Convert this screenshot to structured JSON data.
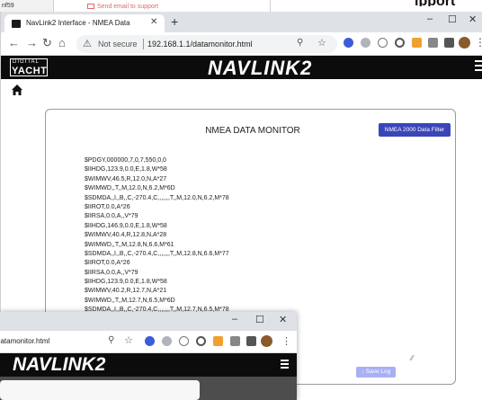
{
  "background_window": {
    "left_fragment": "nf59",
    "mail_link": "Send email to support",
    "right_fragment": "ipport"
  },
  "browser": {
    "tab_title": "NavLink2 Interface - NMEA Data",
    "address": {
      "security": "Not secure",
      "url": "192.168.1.1/datamonitor.html"
    },
    "window_controls": {
      "minimize": "–",
      "maximize": "☐",
      "close": "✕"
    }
  },
  "site": {
    "logo_line1": "DIGITAL",
    "logo_line2": "YACHT",
    "brand": "NAVLINK2"
  },
  "monitor": {
    "title": "NMEA DATA MONITOR",
    "filter_button": "NMEA 2000 Data Filter",
    "save_button": "↓ Save Log",
    "lines": [
      "$PDGY,000000,7,0,7,550,0,0",
      "$IIHDG,123.9,0.0,E,1.8,W*58",
      "$WIMWV,46.5,R,12.0,N,A*27",
      "$WIMWD,,T,,M,12.0,N,6.2,M*6D",
      "$SDMDA,,I,,B,,C,-270.4,C,,,,,,,T,,M,12.0,N,6.2,M*78",
      "$IIROT,0.0,A*26",
      "$IIRSA,0.0,A,,V*79",
      "$IIHDG,146.9,0.0,E,1.8,W*58",
      "$WIMWV,40.4,R,12.8,N,A*28",
      "$WIMWD,,T,,M,12.8,N,6.6,M*61",
      "$SDMDA,,I,,B,,C,-270.4,C,,,,,,,T,,M,12.8,N,6.6,M*77",
      "$IIROT,0.0,A*26",
      "$IIRSA,0.0,A,,V*79",
      "$IIHDG,123.9,0.0,E,1.8,W*58",
      "$WIMWV,40.2,R,12.7,N,A*21",
      "$WIMWD,,T,,M,12.7,N,6.5,M*6D",
      "$SDMDA,,I,,B,,C,-270.4,C,,,,,,,T,,M,12.7,N,6.5,M*78"
    ]
  },
  "second_window": {
    "url_fragment": "datamonitor.html",
    "brand": "NAVLINK2",
    "window_controls": {
      "minimize": "–",
      "maximize": "☐",
      "close": "✕"
    }
  },
  "colors": {
    "header_bg": "#0c0c0c",
    "filter_button_bg": "#3a46b8",
    "save_button_bg": "#a7b0f5",
    "tabbar_bg": "#dee1e6"
  }
}
